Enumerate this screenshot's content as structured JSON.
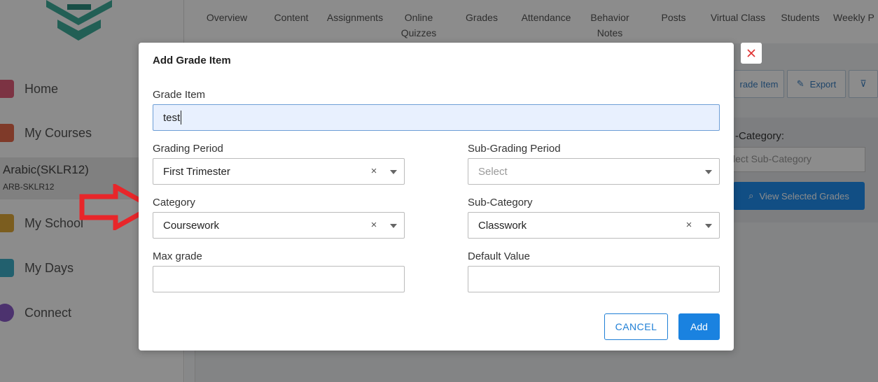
{
  "sidebar": {
    "items": [
      {
        "label": "Home",
        "icon": "home-icon"
      },
      {
        "label": "My Courses",
        "icon": "courses-icon"
      },
      {
        "label": "My School",
        "icon": "school-icon"
      },
      {
        "label": "My Days",
        "icon": "calendar-icon"
      },
      {
        "label": "Connect",
        "icon": "chat-icon"
      }
    ],
    "course": {
      "title": "Arabic(SKLR12)",
      "code": "ARB-SKLR12"
    }
  },
  "tabs": [
    {
      "label": "Overview"
    },
    {
      "label": "Content"
    },
    {
      "label": "Assignments"
    },
    {
      "label": "Online Quizzes"
    },
    {
      "label": "Grades"
    },
    {
      "label": "Attendance"
    },
    {
      "label": "Behavior Notes"
    },
    {
      "label": "Posts"
    },
    {
      "label": "Virtual Class"
    },
    {
      "label": "Students"
    },
    {
      "label": "Weekly P"
    }
  ],
  "toolbar": {
    "add_grade_item": "rade Item",
    "export": "Export"
  },
  "filter_panel": {
    "sub_category_label": "-Category:",
    "sub_category_placeholder": "lect Sub-Category",
    "view_button": "View Selected Grades"
  },
  "modal": {
    "title": "Add Grade Item",
    "grade_item": {
      "label": "Grade Item",
      "value": "test"
    },
    "grading_period": {
      "label": "Grading Period",
      "value": "First Trimester"
    },
    "sub_grading_period": {
      "label": "Sub-Grading Period",
      "placeholder": "Select"
    },
    "category": {
      "label": "Category",
      "value": "Coursework"
    },
    "sub_category": {
      "label": "Sub-Category",
      "value": "Classwork"
    },
    "max_grade": {
      "label": "Max grade",
      "value": ""
    },
    "default_value": {
      "label": "Default Value",
      "value": ""
    },
    "cancel_label": "CANCEL",
    "add_label": "Add"
  },
  "colors": {
    "primary": "#1a82e0",
    "arrow": "#e8262a",
    "close": "#e03030"
  }
}
